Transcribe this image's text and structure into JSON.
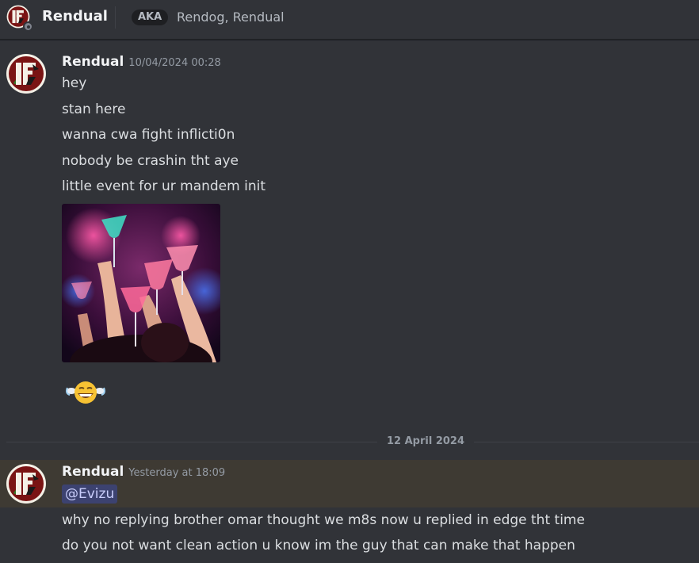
{
  "header": {
    "display_name": "Rendual",
    "aka_badge": "AKA",
    "aka_names": "Rendog, Rendual",
    "status": "offline"
  },
  "messages": [
    {
      "author": "Rendual",
      "timestamp": "10/04/2024 00:28",
      "lines": [
        "hey",
        "stan here",
        "wanna cwa fight inflicti0n",
        "nobody be crashin tht aye",
        "little event for ur mandem init"
      ],
      "attachment": "party-cocktails-image",
      "emoji": "grinning-sweat-face"
    }
  ],
  "date_divider": "12 April 2024",
  "messages2": [
    {
      "author": "Rendual",
      "timestamp": "Yesterday at 18:09",
      "mention": "@Evizu",
      "lines": [
        "why no replying brother omar thought we m8s now u replied in edge tht time",
        "do you not want clean action u know im the guy that can make that happen"
      ]
    }
  ],
  "colors": {
    "background": "#313338",
    "highlight": "#3e3a33",
    "mention_bg": "#3c4270",
    "avatar_red": "#8b1a1a"
  }
}
